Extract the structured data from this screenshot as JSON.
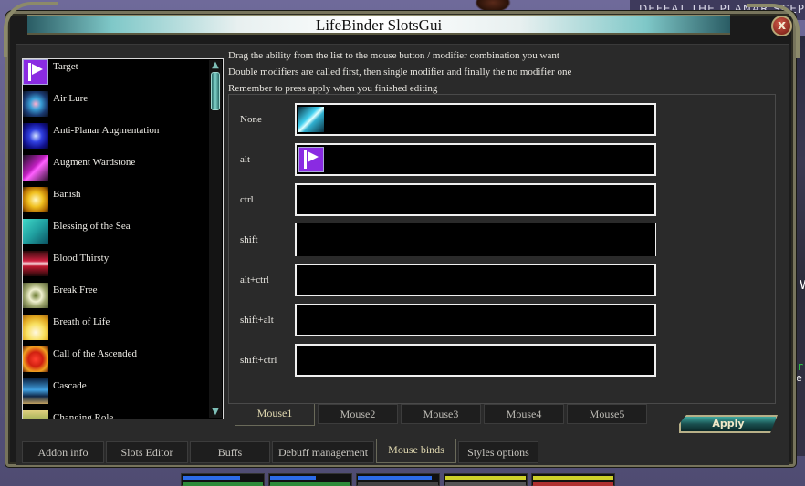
{
  "window": {
    "title": "LifeBinder SlotsGui",
    "close_label": "x"
  },
  "background": {
    "banner_text": "DEFEAT THE PLANAR SCEPTER",
    "side_text_1": "W",
    "side_text_2": "r",
    "side_text_3": "e"
  },
  "instructions": [
    "Drag the ability from the list to the mouse button / modifier combination you want",
    "Double modifiers are called first, then single modifier and finally the no modifier one",
    "Remember to press apply when you finished editing"
  ],
  "abilities": [
    {
      "label": "Target",
      "icon": "target-flag-icon"
    },
    {
      "label": "Air Lure",
      "icon": "air-lure-icon"
    },
    {
      "label": "Anti-Planar Augmentation",
      "icon": "anti-planar-augmentation-icon"
    },
    {
      "label": "Augment Wardstone",
      "icon": "augment-wardstone-icon"
    },
    {
      "label": "Banish",
      "icon": "banish-icon"
    },
    {
      "label": "Blessing of the Sea",
      "icon": "blessing-of-the-sea-icon"
    },
    {
      "label": "Blood Thirsty",
      "icon": "blood-thirsty-icon"
    },
    {
      "label": "Break Free",
      "icon": "break-free-icon"
    },
    {
      "label": "Breath of Life",
      "icon": "breath-of-life-icon"
    },
    {
      "label": "Call of the Ascended",
      "icon": "call-of-the-ascended-icon"
    },
    {
      "label": "Cascade",
      "icon": "cascade-icon"
    },
    {
      "label": "Changing Role",
      "icon": "changing-role-icon"
    }
  ],
  "binds": [
    {
      "modifier": "None",
      "ability_icon": "ice-ability-icon"
    },
    {
      "modifier": "alt",
      "ability_icon": "target-flag-icon"
    },
    {
      "modifier": "ctrl",
      "ability_icon": ""
    },
    {
      "modifier": "shift",
      "ability_icon": ""
    },
    {
      "modifier": "alt+ctrl",
      "ability_icon": ""
    },
    {
      "modifier": "shift+alt",
      "ability_icon": ""
    },
    {
      "modifier": "shift+ctrl",
      "ability_icon": ""
    }
  ],
  "mouse_tabs": [
    {
      "label": "Mouse1",
      "active": true
    },
    {
      "label": "Mouse2",
      "active": false
    },
    {
      "label": "Mouse3",
      "active": false
    },
    {
      "label": "Mouse4",
      "active": false
    },
    {
      "label": "Mouse5",
      "active": false
    }
  ],
  "apply_label": "Apply",
  "main_tabs": [
    {
      "label": "Addon info",
      "active": false
    },
    {
      "label": "Slots Editor",
      "active": false
    },
    {
      "label": "Buffs",
      "active": false
    },
    {
      "label": "Debuff management",
      "active": false
    },
    {
      "label": "Mouse binds",
      "active": true
    },
    {
      "label": "Styles options",
      "active": false
    }
  ],
  "colors": {
    "frame_gold": "#8c8a6a",
    "panel_bg": "#2a2a2a",
    "accent_teal": "#3ea8a0",
    "active_tab_text": "#e0d8b0"
  }
}
